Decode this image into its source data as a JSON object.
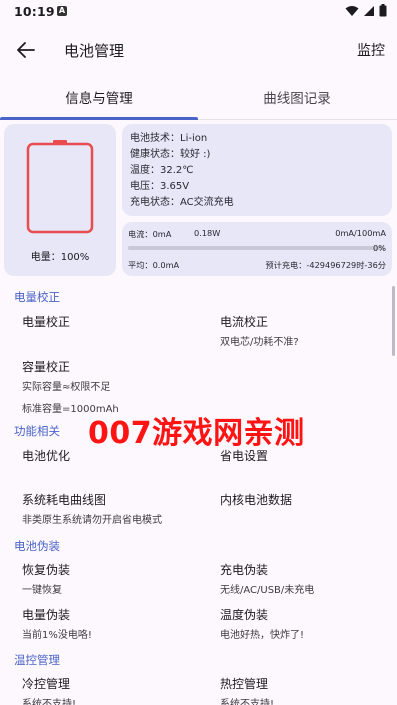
{
  "status_bar": {
    "time": "10:19",
    "notification_glyph": "A",
    "icons": [
      "wifi-icon",
      "signal-icon",
      "battery-icon"
    ]
  },
  "app_bar": {
    "title": "电池管理",
    "action": "监控"
  },
  "tabs": [
    {
      "label": "信息与管理",
      "active": true
    },
    {
      "label": "曲线图记录",
      "active": false
    }
  ],
  "battery_card": {
    "level_label": "电量：",
    "level_value": "100%"
  },
  "battery_info": {
    "technology": "电池技术：Li-ion",
    "health": "健康状态：较好 :)",
    "temperature": "温度：32.2℃",
    "voltage": "电压：3.65V",
    "charge_state": "充电状态：AC交流充电"
  },
  "current": {
    "current_label": "电流：",
    "current_value": "0mA",
    "power": "0.18W",
    "ratio": "0mA/100mA",
    "percent": "0%",
    "average": "平均：0.0mA",
    "estimate": "预计充电：-429496729时-36分"
  },
  "sections": {
    "calibration": {
      "title": "电量校正",
      "items": [
        {
          "label": "电量校正",
          "sub": ""
        },
        {
          "label": "电流校正",
          "sub": "双电芯/功耗不准?"
        },
        {
          "label": "容量校正",
          "sub": "实际容量≈权限不足",
          "sub2": "标准容量=1000mAh"
        }
      ]
    },
    "features": {
      "title": "功能相关",
      "items": [
        {
          "label": "电池优化",
          "sub": ""
        },
        {
          "label": "省电设置",
          "sub": ""
        },
        {
          "label": "系统耗电曲线图",
          "sub": "非类原生系统请勿开启省电模式"
        },
        {
          "label": "内核电池数据",
          "sub": ""
        }
      ]
    },
    "spoof": {
      "title": "电池伪装",
      "items": [
        {
          "label": "恢复伪装",
          "sub": "一键恢复"
        },
        {
          "label": "充电伪装",
          "sub": "无线/AC/USB/未充电"
        },
        {
          "label": "电量伪装",
          "sub": "当前1%没电咯!"
        },
        {
          "label": "温度伪装",
          "sub": "电池好热，快炸了!"
        }
      ]
    },
    "thermal": {
      "title": "温控管理",
      "items": [
        {
          "label": "冷控管理",
          "sub": "系统不支持!"
        },
        {
          "label": "热控管理",
          "sub": "系统不支持!"
        }
      ]
    }
  },
  "watermark": "007游戏网亲测",
  "colors": {
    "accent": "#4a63c9",
    "battery_outline": "#e84c4c",
    "card_bg": "#e7e7f8",
    "watermark": "#ff1414"
  }
}
